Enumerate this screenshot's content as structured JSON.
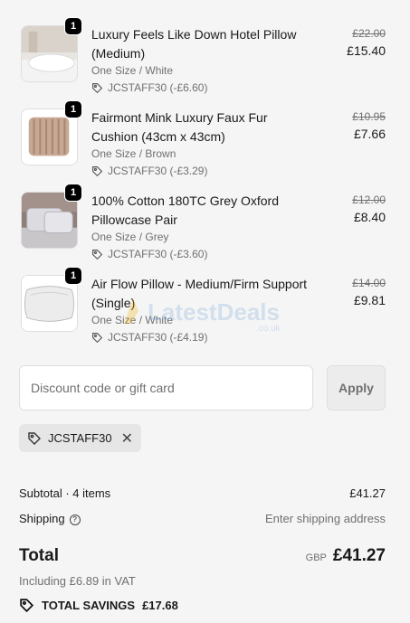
{
  "items": [
    {
      "qty": "1",
      "title": "Luxury Feels Like Down Hotel Pillow (Medium)",
      "variant": "One Size / White",
      "code": "JCSTAFF30 (-£6.60)",
      "old_price": "£22.00",
      "price": "£15.40"
    },
    {
      "qty": "1",
      "title": "Fairmont Mink Luxury Faux Fur Cushion (43cm x 43cm)",
      "variant": "One Size / Brown",
      "code": "JCSTAFF30 (-£3.29)",
      "old_price": "£10.95",
      "price": "£7.66"
    },
    {
      "qty": "1",
      "title": "100% Cotton 180TC Grey Oxford Pillowcase Pair",
      "variant": "One Size / Grey",
      "code": "JCSTAFF30 (-£3.60)",
      "old_price": "£12.00",
      "price": "£8.40"
    },
    {
      "qty": "1",
      "title": "Air Flow Pillow - Medium/Firm Support (Single)",
      "variant": "One Size / White",
      "code": "JCSTAFF30 (-£4.19)",
      "old_price": "£14.00",
      "price": "£9.81"
    }
  ],
  "discount": {
    "placeholder": "Discount code or gift card",
    "apply_label": "Apply",
    "applied_code": "JCSTAFF30"
  },
  "summary": {
    "subtotal_label": "Subtotal · 4 items",
    "subtotal_value": "£41.27",
    "shipping_label": "Shipping",
    "shipping_value": "Enter shipping address",
    "total_label": "Total",
    "currency": "GBP",
    "total_value": "£41.27",
    "vat_note": "Including £6.89 in VAT",
    "savings_label": "TOTAL SAVINGS",
    "savings_value": "£17.68"
  },
  "watermark": "LatestDeals.co.uk"
}
